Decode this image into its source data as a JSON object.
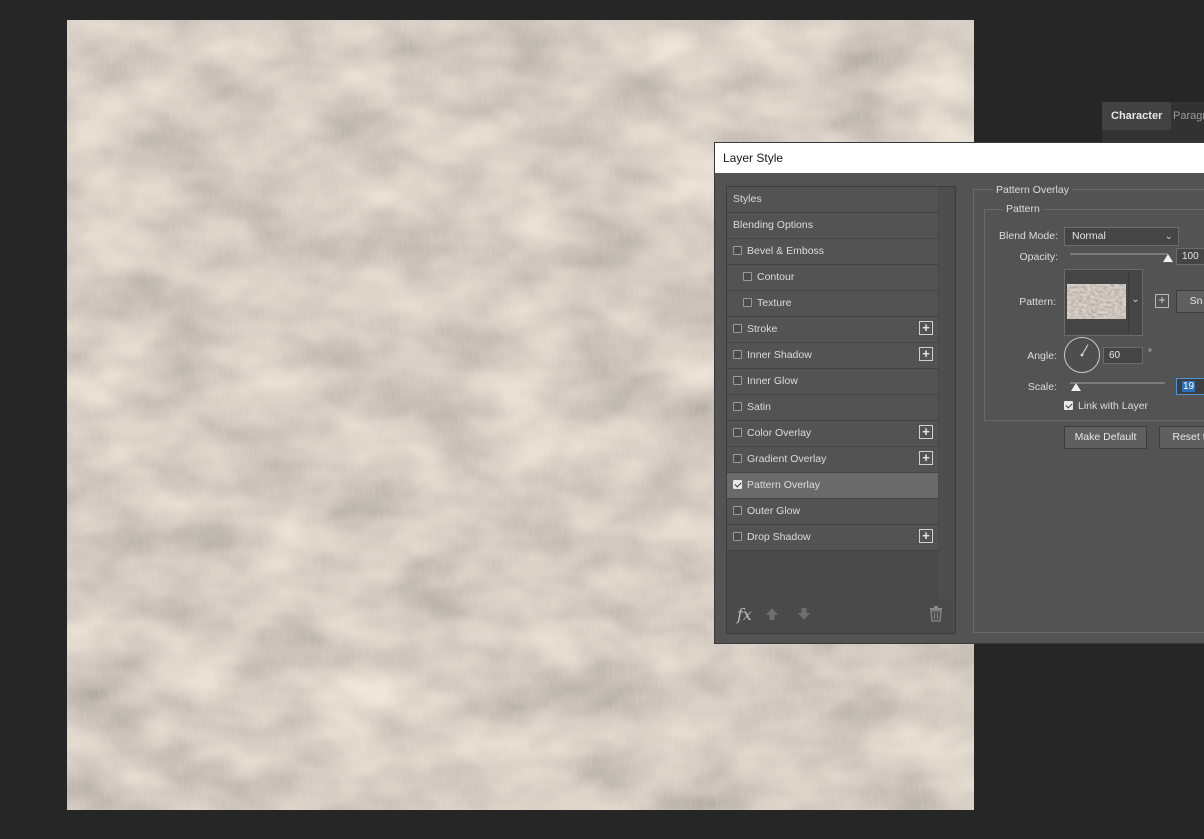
{
  "character_panel": {
    "tabs": [
      {
        "label": "Character",
        "active": true
      },
      {
        "label": "Paragr",
        "active": false
      }
    ]
  },
  "dialog": {
    "title": "Layer Style",
    "styles_list": [
      {
        "label": "Styles",
        "checkbox": false,
        "checked": false,
        "plus": false,
        "indent": 0,
        "selected": false
      },
      {
        "label": "Blending Options",
        "checkbox": false,
        "checked": false,
        "plus": false,
        "indent": 0,
        "selected": false
      },
      {
        "label": "Bevel & Emboss",
        "checkbox": true,
        "checked": false,
        "plus": false,
        "indent": 0,
        "selected": false
      },
      {
        "label": "Contour",
        "checkbox": true,
        "checked": false,
        "plus": false,
        "indent": 1,
        "selected": false
      },
      {
        "label": "Texture",
        "checkbox": true,
        "checked": false,
        "plus": false,
        "indent": 1,
        "selected": false
      },
      {
        "label": "Stroke",
        "checkbox": true,
        "checked": false,
        "plus": true,
        "indent": 0,
        "selected": false
      },
      {
        "label": "Inner Shadow",
        "checkbox": true,
        "checked": false,
        "plus": true,
        "indent": 0,
        "selected": false
      },
      {
        "label": "Inner Glow",
        "checkbox": true,
        "checked": false,
        "plus": false,
        "indent": 0,
        "selected": false
      },
      {
        "label": "Satin",
        "checkbox": true,
        "checked": false,
        "plus": false,
        "indent": 0,
        "selected": false
      },
      {
        "label": "Color Overlay",
        "checkbox": true,
        "checked": false,
        "plus": true,
        "indent": 0,
        "selected": false
      },
      {
        "label": "Gradient Overlay",
        "checkbox": true,
        "checked": false,
        "plus": true,
        "indent": 0,
        "selected": false
      },
      {
        "label": "Pattern Overlay",
        "checkbox": true,
        "checked": true,
        "plus": false,
        "indent": 0,
        "selected": true
      },
      {
        "label": "Outer Glow",
        "checkbox": true,
        "checked": false,
        "plus": false,
        "indent": 0,
        "selected": false
      },
      {
        "label": "Drop Shadow",
        "checkbox": true,
        "checked": false,
        "plus": true,
        "indent": 0,
        "selected": false
      }
    ],
    "footer": {
      "fx_label": "fx"
    },
    "pattern_overlay": {
      "group_title": "Pattern Overlay",
      "inner_group_title": "Pattern",
      "blend_mode_label": "Blend Mode:",
      "blend_mode_value": "Normal",
      "opacity_label": "Opacity:",
      "opacity_value": "100",
      "opacity_fraction": 1.0,
      "pattern_label": "Pattern:",
      "snap_button": "Sn",
      "angle_label": "Angle:",
      "angle_value": "60",
      "angle_degrees": 60,
      "degree_symbol": "°",
      "scale_label": "Scale:",
      "scale_value": "19",
      "scale_fraction": 0.02,
      "link_label": "Link with Layer",
      "link_checked": true,
      "make_default_button": "Make Default",
      "reset_button": "Reset t"
    }
  },
  "colors": {
    "app_background": "#262626",
    "dialog_background": "#535353",
    "selected_row": "#6a6a6a",
    "focus_blue": "#2f70b8"
  }
}
